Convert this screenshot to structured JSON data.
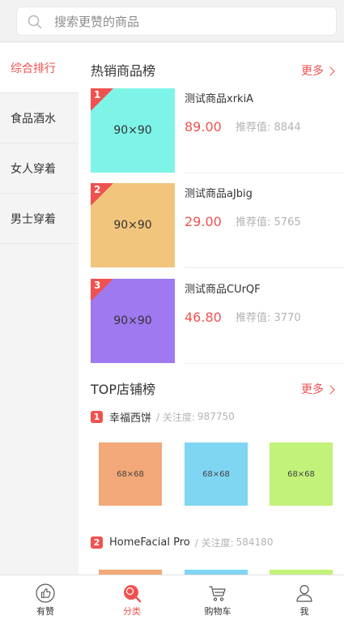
{
  "search": {
    "placeholder": "搜索更赞的商品"
  },
  "sidebar": {
    "items": [
      {
        "label": "综合排行",
        "active": true
      },
      {
        "label": "食品酒水",
        "active": false
      },
      {
        "label": "女人穿着",
        "active": false
      },
      {
        "label": "男士穿着",
        "active": false
      }
    ]
  },
  "hot": {
    "title": "热销商品榜",
    "more": "更多",
    "products": [
      {
        "rank": "1",
        "name": "测试商品xrkiA",
        "price": "89.00",
        "rec_label": "推荐值:",
        "rec": "8844",
        "thumb_label": "90×90",
        "thumb_color": "#7ef4e8"
      },
      {
        "rank": "2",
        "name": "测试商品aJbig",
        "price": "29.00",
        "rec_label": "推荐值:",
        "rec": "5765",
        "thumb_label": "90×90",
        "thumb_color": "#f2c57c"
      },
      {
        "rank": "3",
        "name": "测试商品CUrQF",
        "price": "46.80",
        "rec_label": "推荐值:",
        "rec": "3770",
        "thumb_label": "90×90",
        "thumb_color": "#9e79f0"
      }
    ]
  },
  "shops": {
    "title": "TOP店铺榜",
    "more": "更多",
    "list": [
      {
        "rank": "1",
        "name": "幸福西饼",
        "follow_label": "/ 关注度:",
        "follow": "987750",
        "images": [
          {
            "label": "68×68",
            "color": "#f2a878"
          },
          {
            "label": "68×68",
            "color": "#7fd6f2"
          },
          {
            "label": "68×68",
            "color": "#c2f27a"
          }
        ]
      },
      {
        "rank": "2",
        "name": "HomeFacial Pro",
        "follow_label": "/ 关注度:",
        "follow": "584180",
        "images": [
          {
            "label": "",
            "color": "#f2a878"
          },
          {
            "label": "",
            "color": "#7fd6f2"
          },
          {
            "label": "",
            "color": "#c2f27a"
          }
        ]
      }
    ]
  },
  "tabbar": {
    "items": [
      {
        "label": "有赞",
        "icon": "thumbs-up-icon",
        "active": false
      },
      {
        "label": "分类",
        "icon": "category-search-icon",
        "active": true
      },
      {
        "label": "购物车",
        "icon": "cart-icon",
        "active": false
      },
      {
        "label": "我",
        "icon": "user-icon",
        "active": false
      }
    ]
  },
  "colors": {
    "accent": "#f0524f",
    "sidebar_bg": "#f4f4f4"
  }
}
